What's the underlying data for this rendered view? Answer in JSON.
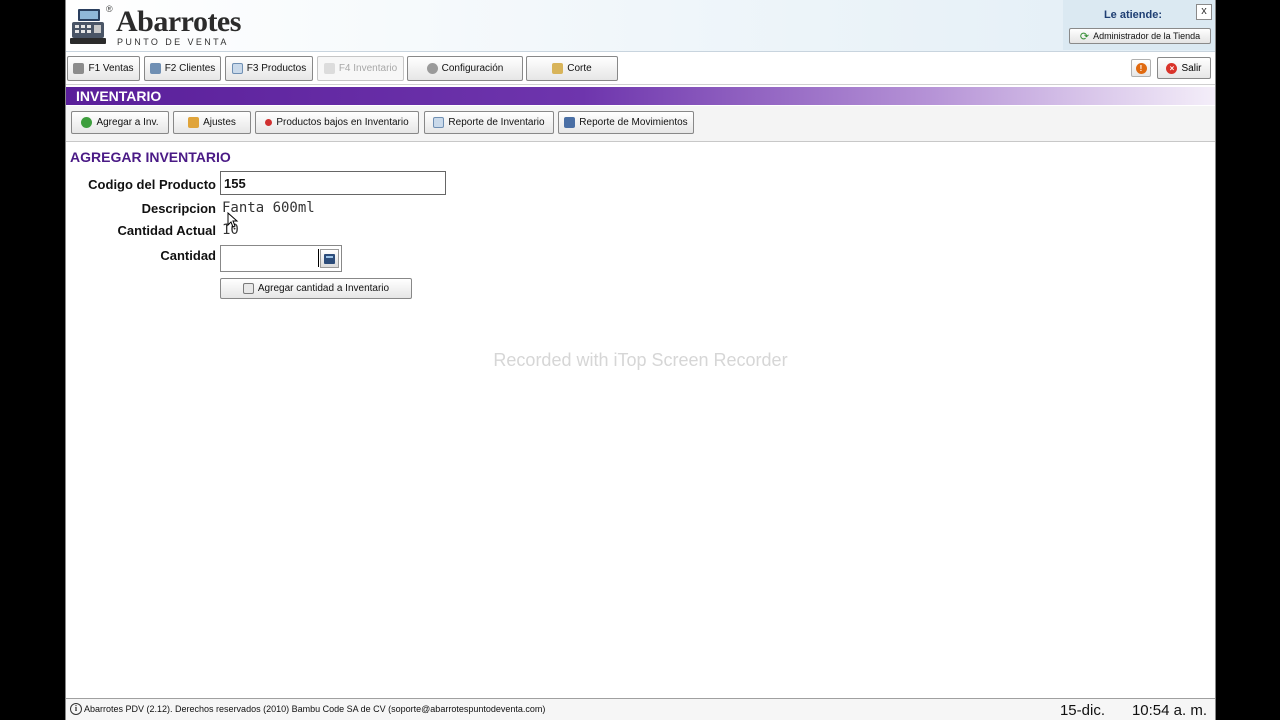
{
  "header": {
    "logo_title": "Abarrotes",
    "logo_reg": "®",
    "logo_subtitle": "PUNTO DE VENTA",
    "attendant_label": "Le atiende:",
    "attendant_name": "Administrador de la Tienda",
    "close_label": "x"
  },
  "nav": {
    "items": [
      {
        "label": "F1 Ventas",
        "icon": "cart-icon"
      },
      {
        "label": "F2 Clientes",
        "icon": "clients-icon"
      },
      {
        "label": "F3 Productos",
        "icon": "products-icon"
      },
      {
        "label": "F4 Inventario",
        "icon": "inventory-icon",
        "disabled": true
      },
      {
        "label": "Configuración",
        "icon": "gear-icon"
      },
      {
        "label": "Corte",
        "icon": "cut-icon"
      }
    ],
    "alert_symbol": "!",
    "logout_label": "Salir"
  },
  "section": {
    "title": "INVENTARIO"
  },
  "subnav": {
    "items": [
      {
        "label": "Agregar a Inv.",
        "icon": "add-icon"
      },
      {
        "label": "Ajustes",
        "icon": "pencil-icon"
      },
      {
        "label": "Productos bajos en Inventario",
        "icon": "low-stock-icon"
      },
      {
        "label": "Reporte de Inventario",
        "icon": "report-icon"
      },
      {
        "label": "Reporte de Movimientos",
        "icon": "book-icon"
      }
    ]
  },
  "form": {
    "title": "AGREGAR INVENTARIO",
    "code_label": "Codigo del Producto",
    "code_value": "155",
    "description_label": "Descripcion",
    "description_value": "Fanta 600ml",
    "current_qty_label": "Cantidad Actual",
    "current_qty_value": "10",
    "qty_label": "Cantidad",
    "qty_value": "",
    "submit_label": "Agregar cantidad a Inventario"
  },
  "watermark": "Recorded with iTop Screen Recorder",
  "footer": {
    "text": "Abarrotes PDV (2.12). Derechos reservados (2010) Bambu Code SA de CV (soporte@abarrotespuntodeventa.com)",
    "date": "15-dic.",
    "time": "10:54 a. m."
  },
  "colors": {
    "accent_purple": "#5a1f9a",
    "title_purple": "#4a1a86"
  }
}
